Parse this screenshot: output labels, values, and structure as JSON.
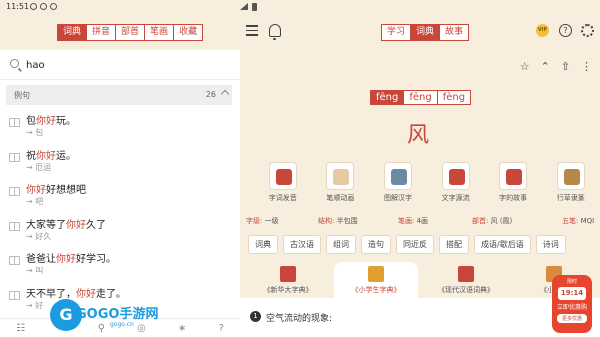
{
  "status": {
    "time": "11:51"
  },
  "top": {
    "left_tabs": [
      "词典",
      "拼音",
      "部首",
      "笔画",
      "收藏"
    ],
    "mid_tabs": [
      "学习",
      "词典",
      "故事"
    ],
    "vip": "VIP"
  },
  "search": {
    "value": "hao"
  },
  "section": {
    "label": "例句",
    "count": "26"
  },
  "results": [
    {
      "pre": "包",
      "hl": "你好",
      "post": "玩。",
      "word": "→ 包"
    },
    {
      "pre": "祝",
      "hl": "你好",
      "post": "运。",
      "word": "→ 厄运"
    },
    {
      "pre": "",
      "hl": "你好",
      "post": "好想想吧",
      "word": "→ 吧"
    },
    {
      "pre": "大家等了",
      "hl": "你好",
      "post": "久了",
      "word": "→ 好久"
    },
    {
      "pre": "爸爸让",
      "hl": "你好",
      "post": "好学习。",
      "word": "→ 叫"
    },
    {
      "pre": "天不早了，",
      "hl": "你好",
      "post": "走了。",
      "word": "→ 好"
    }
  ],
  "bottom_nav": [
    "☷",
    "✎",
    "⚲",
    "◎",
    "∗",
    "?"
  ],
  "entry": {
    "pinyin": [
      "fēng",
      "fēng",
      "fèng"
    ],
    "char": "风",
    "features": [
      {
        "label": "字词发音",
        "icon": "speaker-icon",
        "color": "#c9463a"
      },
      {
        "label": "笔顺动画",
        "icon": "write-icon",
        "color": "#e6c9a0"
      },
      {
        "label": "图解汉字",
        "icon": "picture-icon",
        "color": "#6b8aa3"
      },
      {
        "label": "文字源流",
        "icon": "origin-icon",
        "color": "#c9463a"
      },
      {
        "label": "字的故事",
        "icon": "story-icon",
        "color": "#c9463a"
      },
      {
        "label": "行草隶篆",
        "icon": "brush-icon",
        "color": "#b5874a"
      }
    ],
    "info": {
      "level_label": "字级:",
      "level": "一级",
      "struct_label": "结构:",
      "struct": "半包围",
      "strokes_label": "笔画:",
      "strokes": "4画",
      "radical_label": "部首:",
      "radical": "风 (風)",
      "wubi_label": "五笔:",
      "wubi": "MQI"
    },
    "chips": [
      "词典",
      "古汉语",
      "组词",
      "造句",
      "同近反",
      "搭配",
      "成语/歇后语",
      "诗词"
    ],
    "cards": [
      {
        "label": "《新华大字典》",
        "color": "#c9463a"
      },
      {
        "label": "《小学生字典》",
        "color": "#e0a030"
      },
      {
        "label": "《现代汉语词典》",
        "color": "#c9463a"
      },
      {
        "label": "《小学生",
        "color": "#d98a3a"
      }
    ],
    "definition": {
      "num": "1",
      "text": "空气流动的现象:"
    }
  },
  "promo": {
    "title": "限时",
    "time": "19:14",
    "sub": "立即优惠购",
    "more": "更多优惠"
  },
  "watermark": {
    "logo": "G",
    "text": "GOGO手游网",
    "url": "gogo.cn"
  }
}
